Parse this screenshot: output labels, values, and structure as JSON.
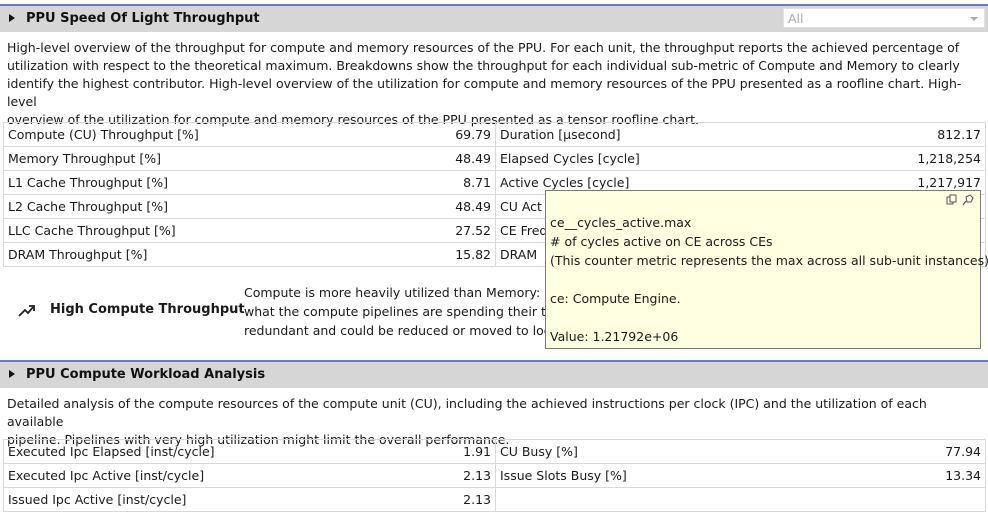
{
  "section1": {
    "title": "PPU Speed Of Light Throughput",
    "filter_value": "All",
    "description": [
      "High-level overview of the throughput for compute and memory resources of the PPU. For each unit, the throughput reports the achieved percentage of",
      "utilization with respect to the theoretical maximum. Breakdowns show the throughput for each individual sub-metric of Compute and Memory to clearly",
      "identify the highest contributor. High-level overview of the utilization for compute and memory resources of the PPU presented as a roofline chart. High-level",
      "overview of the utilization for compute and memory resources of the PPU presented as a tensor roofline chart."
    ],
    "rows": [
      {
        "left_name": "Compute (CU) Throughput [%]",
        "left_value": "69.79",
        "right_name": "Duration [µsecond]",
        "right_value": "812.17"
      },
      {
        "left_name": "Memory Throughput [%]",
        "left_value": "48.49",
        "right_name": "Elapsed Cycles [cycle]",
        "right_value": "1,218,254"
      },
      {
        "left_name": "L1 Cache Throughput [%]",
        "left_value": "8.71",
        "right_name": "Active Cycles [cycle]",
        "right_value": "1,217,917"
      },
      {
        "left_name": "L2 Cache Throughput [%]",
        "left_value": "48.49",
        "right_name": "CU Act",
        "right_value": ""
      },
      {
        "left_name": "LLC Cache Throughput [%]",
        "left_value": "27.52",
        "right_name": "CE Freq",
        "right_value": ""
      },
      {
        "left_name": "DRAM Throughput [%]",
        "left_value": "15.82",
        "right_name": "DRAM",
        "right_value": ""
      }
    ],
    "recommendation": {
      "icon": "trend-up-icon",
      "title": "High Compute Throughput",
      "lines": [
        "Compute is more heavily utilized than Memory: L",
        "what the compute pipelines are spending their tim",
        "redundant and could be reduced or moved to loo"
      ]
    }
  },
  "tooltip": {
    "line1": "ce__cycles_active.max",
    "line2": "# of cycles active on CE across CEs",
    "line3": "(This counter metric represents the max across all sub-unit instances)",
    "line4": "ce: Compute Engine.",
    "line5": "Value: 1.21792e+06",
    "icons": [
      "copy-icon",
      "pin-icon"
    ]
  },
  "section2": {
    "title": "PPU Compute Workload Analysis",
    "description": [
      "Detailed analysis of the compute resources of the compute unit (CU), including the achieved instructions per clock (IPC) and the utilization of each available",
      "pipeline. Pipelines with very high utilization might limit the overall performance."
    ],
    "rows": [
      {
        "left_name": "Executed Ipc Elapsed [inst/cycle]",
        "left_value": "1.91",
        "right_name": "CU Busy [%]",
        "right_value": "77.94"
      },
      {
        "left_name": "Executed Ipc Active [inst/cycle]",
        "left_value": "2.13",
        "right_name": "Issue Slots Busy [%]",
        "right_value": "13.34"
      },
      {
        "left_name": "Issued Ipc Active [inst/cycle]",
        "left_value": "2.13",
        "right_name": "",
        "right_value": ""
      }
    ]
  }
}
